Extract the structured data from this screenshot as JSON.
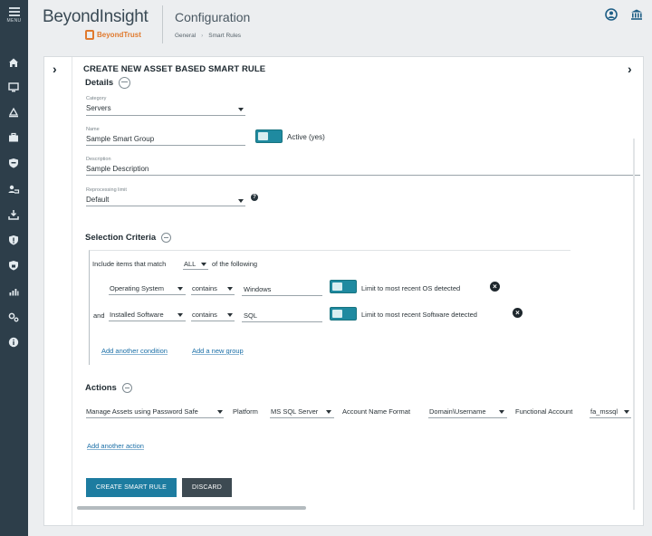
{
  "nav": {
    "menu_label": "MENU",
    "items": [
      "home-icon",
      "monitor-icon",
      "scan-icon",
      "briefcase-icon",
      "shield-icon",
      "cloud-user-icon",
      "download-icon",
      "shield-alert-icon",
      "shield-lock-icon",
      "bar-chart-icon",
      "settings-icon",
      "info-icon"
    ]
  },
  "header": {
    "brand": "BeyondInsight",
    "sub_brand": "BeyondTrust",
    "title": "Configuration",
    "breadcrumbs": [
      "General",
      "Smart Rules"
    ]
  },
  "page": {
    "heading": "CREATE NEW ASSET BASED SMART RULE"
  },
  "details": {
    "heading": "Details",
    "category_label": "Category",
    "category_value": "Servers",
    "name_label": "Name",
    "name_value": "Sample Smart Group",
    "active_label": "Active (yes)",
    "description_label": "Description",
    "description_value": "Sample Description",
    "reprocessing_label": "Reprocessing limit",
    "reprocessing_value": "Default"
  },
  "criteria": {
    "heading": "Selection Criteria",
    "include_prefix": "Include items that match",
    "match_value": "ALL",
    "include_suffix": "of the following",
    "rows": [
      {
        "prefix": "",
        "field": "Operating System",
        "operator": "contains",
        "value": "Windows",
        "toggle_label": "Limit to most recent OS detected"
      },
      {
        "prefix": "and",
        "field": "Installed Software",
        "operator": "contains",
        "value": "SQL",
        "toggle_label": "Limit to most recent Software detected"
      }
    ],
    "add_condition": "Add another condition",
    "add_group": "Add a new group"
  },
  "actions": {
    "heading": "Actions",
    "action_value": "Manage Assets using Password Safe",
    "platform_label": "Platform",
    "platform_value": "MS SQL Server",
    "account_format_label": "Account Name Format",
    "account_format_value": "Domain\\Username",
    "functional_account_label": "Functional Account",
    "functional_account_value": "fa_mssql",
    "add_action": "Add another action"
  },
  "buttons": {
    "create": "CREATE SMART RULE",
    "discard": "DISCARD"
  },
  "colors": {
    "nav_bg": "#2d3e4a",
    "accent": "#1f8aa0",
    "primary_button": "#1d7ca0",
    "secondary_button": "#3d4a52",
    "brand_orange": "#e07a2e"
  }
}
